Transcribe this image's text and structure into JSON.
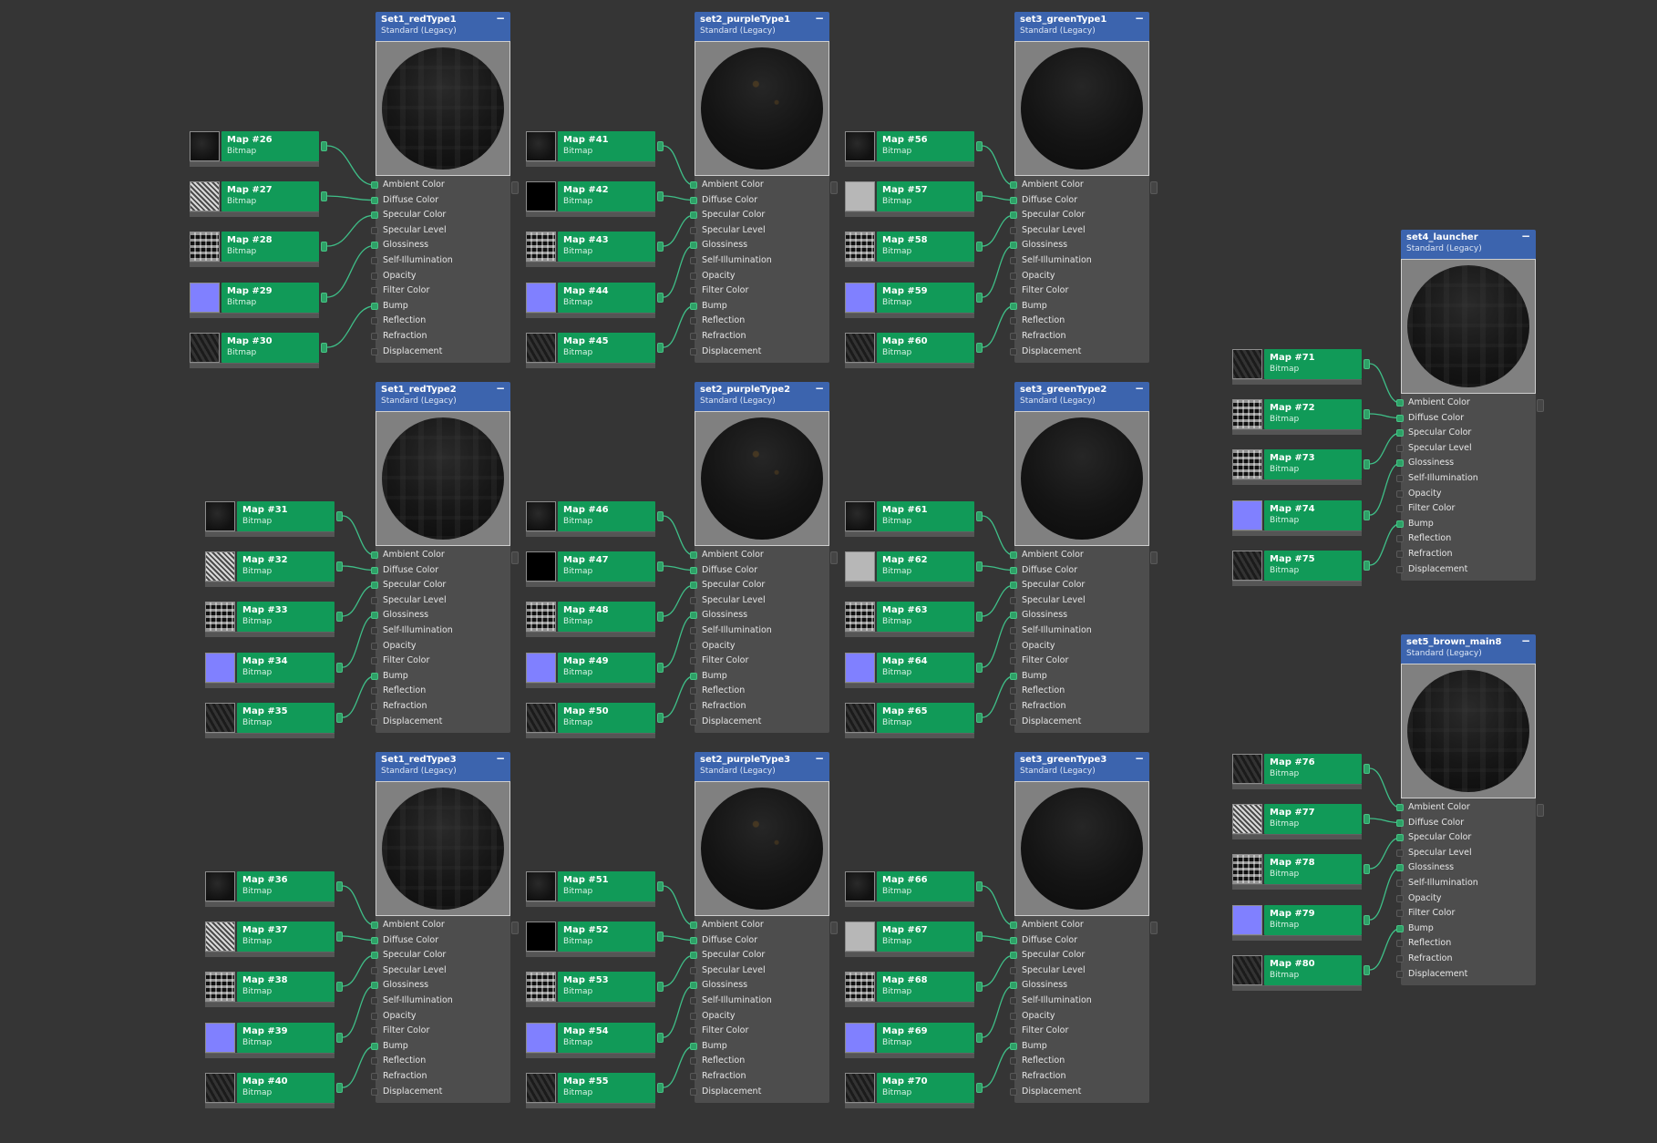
{
  "common": {
    "material_type": "Standard (Legacy)",
    "map_type": "Bitmap",
    "minimize_glyph": "−",
    "slots": [
      "Ambient Color",
      "Diffuse Color",
      "Specular Color",
      "Specular Level",
      "Glossiness",
      "Self-Illumination",
      "Opacity",
      "Filter Color",
      "Bump",
      "Reflection",
      "Refraction",
      "Displacement"
    ]
  },
  "colors": {
    "background": "#353535",
    "material_header": "#3c64ae",
    "map_node": "#119a58",
    "wire": "#3fbf88"
  },
  "materials": [
    {
      "name": "Set1_redType1",
      "style": "red",
      "maps": [
        {
          "name": "Map #26",
          "thumb": "dark"
        },
        {
          "name": "Map #27",
          "thumb": "noise"
        },
        {
          "name": "Map #28",
          "thumb": "mixed"
        },
        {
          "name": "Map #29",
          "thumb": "blue"
        },
        {
          "name": "Map #30",
          "thumb": "scrap"
        }
      ]
    },
    {
      "name": "set2_purpleType1",
      "style": "purple",
      "maps": [
        {
          "name": "Map #41",
          "thumb": "dark"
        },
        {
          "name": "Map #42",
          "thumb": "black"
        },
        {
          "name": "Map #43",
          "thumb": "mixed"
        },
        {
          "name": "Map #44",
          "thumb": "blue"
        },
        {
          "name": "Map #45",
          "thumb": "scrap"
        }
      ]
    },
    {
      "name": "set3_greenType1",
      "style": "green",
      "maps": [
        {
          "name": "Map #56",
          "thumb": "dark"
        },
        {
          "name": "Map #57",
          "thumb": "gray"
        },
        {
          "name": "Map #58",
          "thumb": "mixed"
        },
        {
          "name": "Map #59",
          "thumb": "blue"
        },
        {
          "name": "Map #60",
          "thumb": "scrap"
        }
      ]
    },
    {
      "name": "Set1_redType2",
      "style": "red",
      "maps": [
        {
          "name": "Map #31",
          "thumb": "dark"
        },
        {
          "name": "Map #32",
          "thumb": "noise"
        },
        {
          "name": "Map #33",
          "thumb": "mixed"
        },
        {
          "name": "Map #34",
          "thumb": "blue"
        },
        {
          "name": "Map #35",
          "thumb": "scrap"
        }
      ]
    },
    {
      "name": "set2_purpleType2",
      "style": "purple",
      "maps": [
        {
          "name": "Map #46",
          "thumb": "dark"
        },
        {
          "name": "Map #47",
          "thumb": "black"
        },
        {
          "name": "Map #48",
          "thumb": "mixed"
        },
        {
          "name": "Map #49",
          "thumb": "blue"
        },
        {
          "name": "Map #50",
          "thumb": "scrap"
        }
      ]
    },
    {
      "name": "set3_greenType2",
      "style": "green",
      "maps": [
        {
          "name": "Map #61",
          "thumb": "dark"
        },
        {
          "name": "Map #62",
          "thumb": "gray"
        },
        {
          "name": "Map #63",
          "thumb": "mixed"
        },
        {
          "name": "Map #64",
          "thumb": "blue"
        },
        {
          "name": "Map #65",
          "thumb": "scrap"
        }
      ]
    },
    {
      "name": "Set1_redType3",
      "style": "red",
      "maps": [
        {
          "name": "Map #36",
          "thumb": "dark"
        },
        {
          "name": "Map #37",
          "thumb": "noise"
        },
        {
          "name": "Map #38",
          "thumb": "mixed"
        },
        {
          "name": "Map #39",
          "thumb": "blue"
        },
        {
          "name": "Map #40",
          "thumb": "scrap"
        }
      ]
    },
    {
      "name": "set2_purpleType3",
      "style": "purple",
      "maps": [
        {
          "name": "Map #51",
          "thumb": "dark"
        },
        {
          "name": "Map #52",
          "thumb": "black"
        },
        {
          "name": "Map #53",
          "thumb": "mixed"
        },
        {
          "name": "Map #54",
          "thumb": "blue"
        },
        {
          "name": "Map #55",
          "thumb": "scrap"
        }
      ]
    },
    {
      "name": "set3_greenType3",
      "style": "green",
      "maps": [
        {
          "name": "Map #66",
          "thumb": "dark"
        },
        {
          "name": "Map #67",
          "thumb": "gray"
        },
        {
          "name": "Map #68",
          "thumb": "mixed"
        },
        {
          "name": "Map #69",
          "thumb": "blue"
        },
        {
          "name": "Map #70",
          "thumb": "scrap"
        }
      ]
    },
    {
      "name": "set4_launcher",
      "style": "brown",
      "maps": [
        {
          "name": "Map #71",
          "thumb": "scrap"
        },
        {
          "name": "Map #72",
          "thumb": "mixed"
        },
        {
          "name": "Map #73",
          "thumb": "mixed"
        },
        {
          "name": "Map #74",
          "thumb": "blue"
        },
        {
          "name": "Map #75",
          "thumb": "scrap"
        }
      ]
    },
    {
      "name": "set5_brown_main8",
      "style": "brown",
      "maps": [
        {
          "name": "Map #76",
          "thumb": "scrap"
        },
        {
          "name": "Map #77",
          "thumb": "noise"
        },
        {
          "name": "Map #78",
          "thumb": "mixed"
        },
        {
          "name": "Map #79",
          "thumb": "blue"
        },
        {
          "name": "Map #80",
          "thumb": "scrap"
        }
      ]
    }
  ]
}
